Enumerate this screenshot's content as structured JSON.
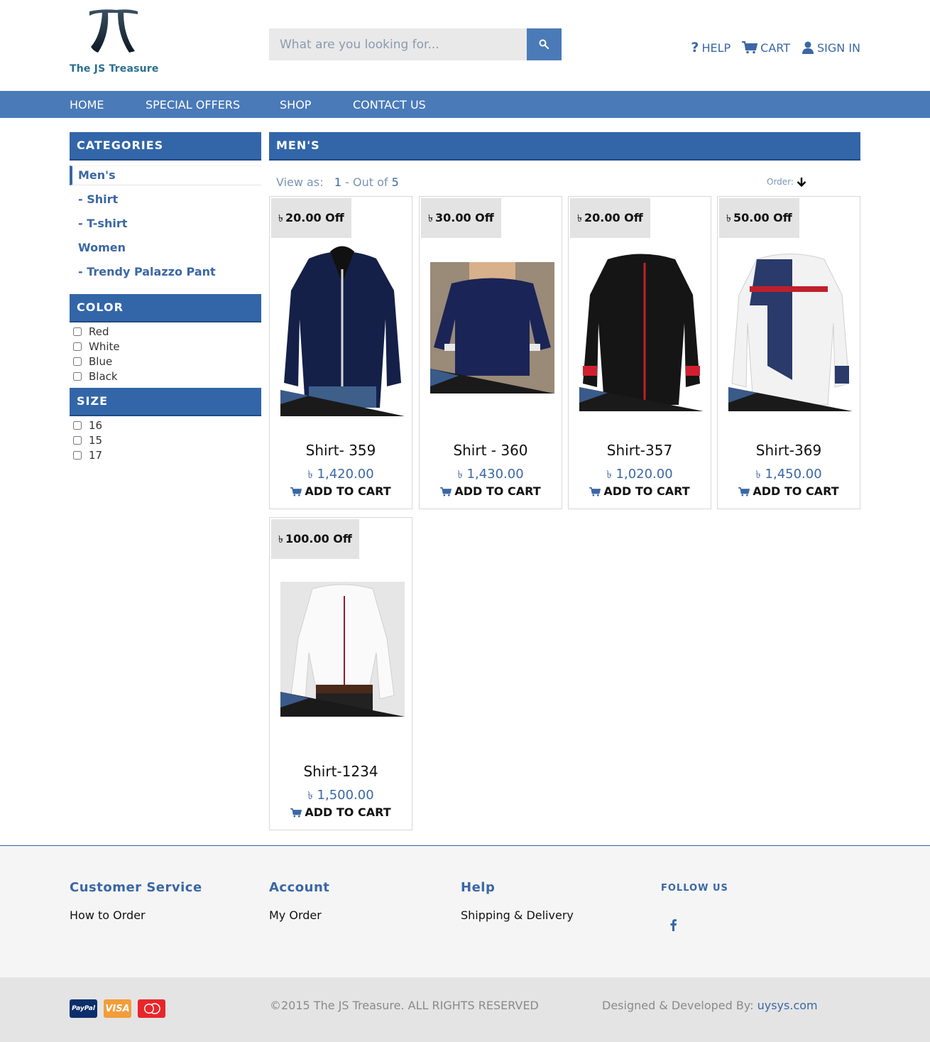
{
  "brand": {
    "name": "The JS Treasure"
  },
  "search": {
    "placeholder": "What are you looking for..."
  },
  "toplinks": {
    "help": "HELP",
    "cart": "CART",
    "signin": "SIGN IN"
  },
  "nav": {
    "home": "HOME",
    "special": "SPECIAL OFFERS",
    "shop": "SHOP",
    "contact": "CONTACT US"
  },
  "sidebar": {
    "categories_title": "CATEGORIES",
    "categories": [
      "Men's",
      "- Shirt",
      "- T-shirt",
      "Women",
      "- Trendy Palazzo Pant"
    ],
    "color_title": "COLOR",
    "colors": [
      "Red",
      "White",
      "Blue",
      "Black"
    ],
    "size_title": "SIZE",
    "sizes": [
      "16",
      "15",
      "17"
    ]
  },
  "main": {
    "title": "MEN'S",
    "view_as": "View as:",
    "page_current": "1",
    "page_sep": " - ",
    "out_of": "Out of ",
    "page_total": "5",
    "order_label": "Order:"
  },
  "currency_symbol": "৳",
  "products": [
    {
      "discount": "20.00 Off",
      "name": "Shirt- 359",
      "price": "1,420.00",
      "cta": "ADD TO CART"
    },
    {
      "discount": "30.00 Off",
      "name": "Shirt - 360",
      "price": "1,430.00",
      "cta": "ADD TO CART"
    },
    {
      "discount": "20.00 Off",
      "name": "Shirt-357",
      "price": "1,020.00",
      "cta": "ADD TO CART"
    },
    {
      "discount": "50.00 Off",
      "name": "Shirt-369",
      "price": "1,450.00",
      "cta": "ADD TO CART"
    },
    {
      "discount": "100.00 Off",
      "name": "Shirt-1234",
      "price": "1,500.00",
      "cta": "ADD TO CART"
    }
  ],
  "footer": {
    "customer_service": {
      "title": "Customer Service",
      "link": "How to Order"
    },
    "account": {
      "title": "Account",
      "link": "My Order"
    },
    "help": {
      "title": "Help",
      "link": "Shipping & Delivery"
    },
    "follow_title": "FOLLOW US",
    "payments": [
      "PayPal",
      "VISA",
      "MasterCard"
    ],
    "copyright": "©2015 The JS Treasure. ALL RIGHTS RESERVED",
    "designed_by": "Designed & Developed By: ",
    "developer": "uysys.com"
  },
  "colors": {
    "primary": "#3366a8",
    "nav": "#4a7ab8",
    "link": "#3b67a5"
  }
}
